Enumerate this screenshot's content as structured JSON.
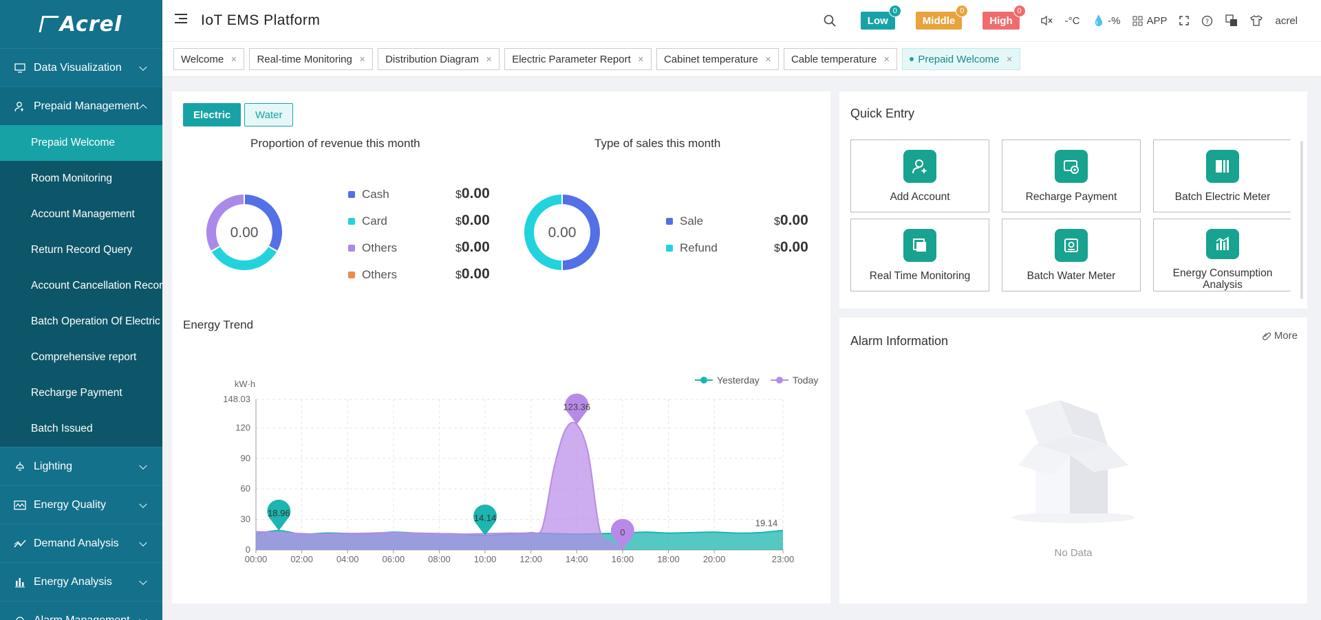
{
  "brand": {
    "logo_text": "Acrel"
  },
  "header": {
    "title": "IoT EMS Platform",
    "alarms": [
      {
        "label": "Low",
        "count": "0",
        "color": "#17a3a6",
        "badge_color": "#17a3a6"
      },
      {
        "label": "Middle",
        "count": "0",
        "color": "#e8a33d",
        "badge_color": "#e8a33d"
      },
      {
        "label": "High",
        "count": "0",
        "color": "#f06c6c",
        "badge_color": "#f06c6c"
      }
    ],
    "temperature": "-°C",
    "humidity": "-%",
    "app_label": "APP",
    "user": "acrel"
  },
  "sidebar": {
    "groups": [
      {
        "label": "Data Visualization",
        "icon": "monitor-icon"
      },
      {
        "label": "Prepaid Management",
        "icon": "user-card-icon",
        "expanded": true
      }
    ],
    "sub_items": [
      "Prepaid Welcome",
      "Room Monitoring",
      "Account Management",
      "Return Record Query",
      "Account Cancellation Record",
      "Batch Operation Of Electric",
      "Comprehensive report",
      "Recharge Payment",
      "Batch Issued"
    ],
    "groups_after": [
      {
        "label": "Lighting",
        "icon": "lamp-icon"
      },
      {
        "label": "Energy Quality",
        "icon": "wave-icon"
      },
      {
        "label": "Demand Analysis",
        "icon": "trend-icon"
      },
      {
        "label": "Energy Analysis",
        "icon": "bar-chart-icon"
      },
      {
        "label": "Alarm Management",
        "icon": "alarm-icon"
      }
    ]
  },
  "tabs": [
    {
      "label": "Welcome"
    },
    {
      "label": "Real-time Monitoring"
    },
    {
      "label": "Distribution Diagram"
    },
    {
      "label": "Electric Parameter Report"
    },
    {
      "label": "Cabinet temperature"
    },
    {
      "label": "Cable temperature"
    },
    {
      "label": "Prepaid Welcome",
      "active": true
    }
  ],
  "toggle": {
    "electric": "Electric",
    "water": "Water"
  },
  "revenue": {
    "title": "Proportion of revenue this month",
    "center": "0.00",
    "currency": "$",
    "items": [
      {
        "label": "Cash",
        "value": "0.00",
        "color": "#5470e6"
      },
      {
        "label": "Card",
        "value": "0.00",
        "color": "#22d3de"
      },
      {
        "label": "Others",
        "value": "0.00",
        "color": "#a98ae8"
      },
      {
        "label": "Others",
        "value": "0.00",
        "color": "#f08a4b"
      }
    ]
  },
  "sales": {
    "title": "Type of sales this month",
    "center": "0.00",
    "currency": "$",
    "items": [
      {
        "label": "Sale",
        "value": "0.00",
        "color": "#5470e6"
      },
      {
        "label": "Refund",
        "value": "0.00",
        "color": "#22d3de"
      }
    ]
  },
  "energy_trend": {
    "title": "Energy Trend"
  },
  "chart_data": {
    "type": "area",
    "ylabel": "kW·h",
    "ylim": [
      0,
      148.03
    ],
    "yticks": [
      "0",
      "30",
      "60",
      "90",
      "120",
      "148.03"
    ],
    "xticks": [
      "00:00",
      "02:00",
      "04:00",
      "06:00",
      "08:00",
      "10:00",
      "12:00",
      "14:00",
      "16:00",
      "18:00",
      "20:00",
      "23:00"
    ],
    "xticks_hours": [
      0,
      2,
      4,
      6,
      8,
      10,
      12,
      14,
      16,
      18,
      20,
      23
    ],
    "legend_position": "top-right",
    "series": [
      {
        "name": "Yesterday",
        "color": "#1cb5b0",
        "x": [
          0,
          1,
          2,
          3,
          4,
          5,
          6,
          7,
          8,
          9,
          10,
          11,
          12,
          13,
          14,
          15,
          16,
          17,
          18,
          19,
          20,
          21,
          22,
          23
        ],
        "values": [
          16,
          18.96,
          15.5,
          16.5,
          16.2,
          15.8,
          17.5,
          16.5,
          16,
          15.5,
          14.14,
          15.5,
          16.5,
          16,
          15.5,
          16,
          16.5,
          17.5,
          16.5,
          17,
          17.5,
          16.5,
          17,
          19.14
        ],
        "markers": [
          {
            "x": 1,
            "label": "18.96"
          },
          {
            "x": 10,
            "label": "14.14"
          },
          {
            "x": 23,
            "label": "19.14"
          }
        ]
      },
      {
        "name": "Today",
        "color": "#b88ae8",
        "x": [
          0,
          1,
          2,
          3,
          4,
          5,
          6,
          7,
          8,
          9,
          10,
          11,
          12,
          12.5,
          13,
          13.5,
          14,
          14.5,
          15,
          15.5,
          16
        ],
        "values": [
          18,
          17,
          16,
          15.5,
          16,
          16.5,
          17,
          16.5,
          16,
          15.5,
          16,
          16.5,
          17,
          22,
          80,
          118,
          123.36,
          95,
          20,
          8,
          0
        ],
        "markers": [
          {
            "x": 14,
            "label": "123.36"
          },
          {
            "x": 16,
            "label": "0"
          }
        ]
      }
    ]
  },
  "quick_entry": {
    "title": "Quick Entry",
    "items": [
      {
        "label": "Add Account",
        "icon": "add-user-icon"
      },
      {
        "label": "Recharge Payment",
        "icon": "recharge-icon"
      },
      {
        "label": "Batch Electric Meter",
        "icon": "meter-icon"
      },
      {
        "label": "Real Time Monitoring",
        "icon": "monitoring-icon"
      },
      {
        "label": "Batch Water Meter",
        "icon": "water-meter-icon"
      },
      {
        "label": "Energy Consumption Analysis",
        "icon": "analysis-icon"
      }
    ]
  },
  "alarm_info": {
    "title": "Alarm Information",
    "more": "More",
    "empty": "No Data"
  }
}
